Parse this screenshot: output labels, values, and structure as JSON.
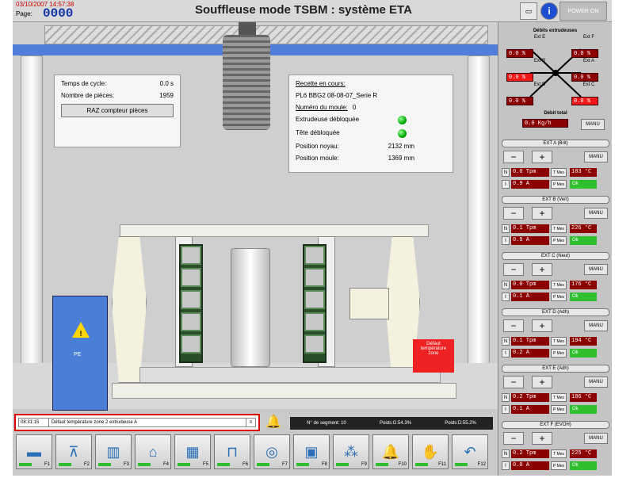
{
  "header": {
    "datetime": "03/10/2007  14:57:38",
    "page_label": "Page:",
    "page_number": "0000",
    "title": "Souffleuse mode TSBM : système ETA",
    "power_label": "POWER ON"
  },
  "cycle_panel": {
    "cycle_time_label": "Temps de cycle:",
    "cycle_time_value": "0.0 s",
    "parts_label": "Nombre de pièces:",
    "parts_value": "1959",
    "reset_button": "RAZ compteur pièces"
  },
  "recipe_panel": {
    "recipe_label": "Recette en cours:",
    "recipe_name": "PL6 BBG2 08-08-07_Serie R",
    "mold_number_label": "Numéro du moule:",
    "mold_number_value": "0",
    "extruder_unlocked": "Extrudeuse débloquée",
    "head_unlocked": "Tête débloquée",
    "core_position_label": "Position noyau:",
    "core_position_value": "2132 mm",
    "mold_position_label": "Position moule:",
    "mold_position_value": "1369 mm"
  },
  "machine": {
    "alarm_box_text": "Défaut température zone",
    "cabinet_label": "PE"
  },
  "extruder_flows": {
    "title": "Débits extrudeuses",
    "items": [
      {
        "label": "Ext E",
        "value": "0.0 %",
        "alarm": false
      },
      {
        "label": "Ext F",
        "value": "0.0 %",
        "alarm": false
      },
      {
        "label": "Ext B",
        "value": "0.0 %",
        "alarm": true
      },
      {
        "label": "Ext A",
        "value": "0.0 %",
        "alarm": false
      },
      {
        "label": "Ext D",
        "value": "0.0 %",
        "alarm": false
      },
      {
        "label": "Ext C",
        "value": "0.0 %",
        "alarm": true
      }
    ],
    "total_label": "Débit total",
    "total_value": "0.0 Kg/h",
    "manu_label": "MANU"
  },
  "extruders": [
    {
      "name": "EXT A (Brit)",
      "speed": "0.0 Tpm",
      "current": "0.9 A",
      "temp": "183 °C",
      "state": "Ok"
    },
    {
      "name": "EXT B (Vert)",
      "speed": "0.1 Tpm",
      "current": "0.9 A",
      "temp": "226 °C",
      "state": "Ok"
    },
    {
      "name": "EXT C (Neut)",
      "speed": "0.0 Tpm",
      "current": "0.1 A",
      "temp": "176 °C",
      "state": "Ok"
    },
    {
      "name": "EXT D (Adh)",
      "speed": "0.1 Tpm",
      "current": "0.2 A",
      "temp": "194 °C",
      "state": "Ok"
    },
    {
      "name": "EXT E (Adh)",
      "speed": "0.2 Tpm",
      "current": "0.1 A",
      "temp": "186 °C",
      "state": "Ok"
    },
    {
      "name": "EXT F (EVOH)",
      "speed": "0.2 Tpm",
      "current": "0.0 A",
      "temp": "225 °C",
      "state": "Ok"
    }
  ],
  "ext_controls": {
    "minus": "−",
    "plus": "+",
    "manu": "MANU",
    "n_label": "N",
    "i_label": "I",
    "tmes_label": "T Mes",
    "pmes_label": "P Mes"
  },
  "alarm_bar": {
    "time": "08:31:15",
    "message": "Défaut température zone 2 extrudeuse A"
  },
  "status": {
    "segment_label": "N° de segment: 10",
    "weight1": "Poids:G:54.3%",
    "weight2": "Poids:D:55.2%"
  },
  "function_keys": [
    {
      "key": "F1",
      "icon": "pipe-icon"
    },
    {
      "key": "F2",
      "icon": "head-icon"
    },
    {
      "key": "F3",
      "icon": "mold-icon"
    },
    {
      "key": "F4",
      "icon": "press-icon"
    },
    {
      "key": "F5",
      "icon": "frame-icon"
    },
    {
      "key": "F6",
      "icon": "cooling-icon"
    },
    {
      "key": "F7",
      "icon": "coins-icon"
    },
    {
      "key": "F8",
      "icon": "computer-icon"
    },
    {
      "key": "F9",
      "icon": "network-icon"
    },
    {
      "key": "F10",
      "icon": "bell-icon"
    },
    {
      "key": "F11",
      "icon": "hand-icon"
    },
    {
      "key": "F12",
      "icon": "return-icon"
    }
  ]
}
